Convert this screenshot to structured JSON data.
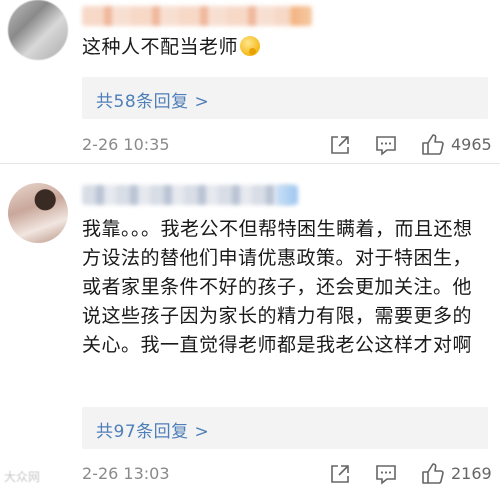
{
  "comments": [
    {
      "text": "这种人不配当老师",
      "replies_label": "共58条回复 >",
      "time": "2-26 10:35",
      "likes": "4965"
    },
    {
      "text": "我靠。。。我老公不但帮特困生瞒着，而且还想方设法的替他们申请优惠政策。对于特困生，或者家里条件不好的孩子，还会更加关注。他说这些孩子因为家长的精力有限，需要更多的关心。我一直觉得老师都是我老公这样才对啊",
      "replies_label": "共97条回复 >",
      "time": "2-26 13:03",
      "likes": "2169"
    }
  ],
  "icons": {
    "emoji": "thinking-face",
    "share": "share-icon",
    "reply": "comment-icon",
    "like": "thumbs-up-icon"
  },
  "colors": {
    "link": "#4f7fb8",
    "meta": "#8a8a8a",
    "reply_box_bg": "#f3f3f3"
  },
  "watermark": "大众网"
}
